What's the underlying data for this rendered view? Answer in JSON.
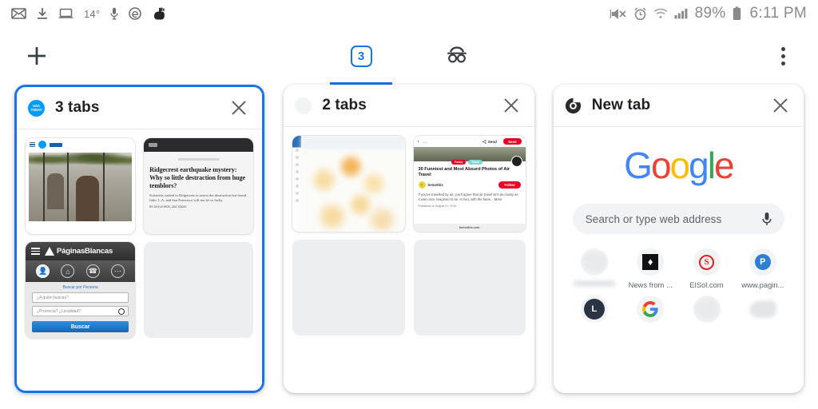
{
  "statusbar": {
    "left_icons": [
      "mail-icon",
      "download-icon",
      "laptop-icon",
      "mic-icon",
      "edge-icon",
      "app-icon"
    ],
    "temperature": "14°",
    "right_icons": [
      "mute-icon",
      "alarm-icon",
      "wifi-icon",
      "signal-icon",
      "battery-icon"
    ],
    "battery_percent": "89%",
    "time": "6:11 PM"
  },
  "toolbar": {
    "new_tab_label": "+",
    "tab_count": "3",
    "incognito_label": "incognito-icon",
    "menu_label": "⋮"
  },
  "cards": [
    {
      "title": "3 tabs",
      "favicon": "usatoday-favicon",
      "favicon_text": "USA TODAY",
      "close_label": "✕",
      "selected": true,
      "thumbs": [
        {
          "type": "usatoday-article-photo",
          "site": "USA TODAY"
        },
        {
          "type": "article-text",
          "headline": "Ridgecrest earthquake mystery: Why so little destraction from huge temblors?",
          "body": "Scientists rushed to Ridgecrest to assess the destruction but found little. L.A. and San Francisco will not be so lucky.",
          "byline": "BY DOYLE RICE, USA TODAY"
        },
        {
          "type": "paginasblancas",
          "brand_prefix": "Páginas",
          "brand_suffix": "Blancas",
          "subtitle": "Buscar por",
          "subtitle_link": "Persona",
          "field1": "¿A quién buscas?",
          "field2": "¿Provincia? ¿Localidad?",
          "button": "Buscar"
        },
        {
          "type": "empty"
        }
      ]
    },
    {
      "title": "2 tabs",
      "favicon": "faint-favicon",
      "close_label": "✕",
      "selected": false,
      "thumbs": [
        {
          "type": "blurred-page"
        },
        {
          "type": "pinterest-pin",
          "send_label": "Send",
          "save_label": "Save",
          "tag1": "Funny",
          "tag2": "Travel",
          "title": "30 Funniest and Most Absurd Photos of Air Travel",
          "author": "bemethis",
          "follow_label": "Follow",
          "description": "If you've travelled by air, you'll agree that air travel isn't as classy as it was once imagined to be. In fact, with the fares... More",
          "published": "Published on August 21, 2019",
          "footer": "bemethis.com"
        },
        {
          "type": "empty"
        },
        {
          "type": "empty"
        }
      ]
    },
    {
      "title": "New tab",
      "favicon": "chrome-favicon",
      "close_label": "✕",
      "selected": false,
      "newtab": {
        "logo_letters": [
          "G",
          "o",
          "o",
          "g",
          "l",
          "e"
        ],
        "search_placeholder": "Search or type web address",
        "mic_label": "mic-icon",
        "shortcuts": [
          {
            "label": "",
            "icon": "blurred-icon",
            "blurred": true
          },
          {
            "label": "News from ...",
            "icon": "news-icon",
            "blurred": false
          },
          {
            "label": "ElSol.com",
            "icon": "elsol-icon",
            "blurred": false
          },
          {
            "label": "www.pagin...",
            "icon": "p-icon",
            "blurred": false
          },
          {
            "label": "",
            "icon": "l-icon",
            "blurred": false
          },
          {
            "label": "",
            "icon": "google-g-icon",
            "blurred": false
          },
          {
            "label": "",
            "icon": "blurred-icon",
            "blurred": false
          },
          {
            "label": "",
            "icon": "blurred-icon",
            "blurred": false
          }
        ]
      }
    }
  ],
  "colors": {
    "accent": "#1a73e8",
    "google_blue": "#4285f4",
    "google_red": "#ea4335",
    "google_yellow": "#fbbc05",
    "google_green": "#34a853",
    "pinterest_red": "#e60023"
  }
}
